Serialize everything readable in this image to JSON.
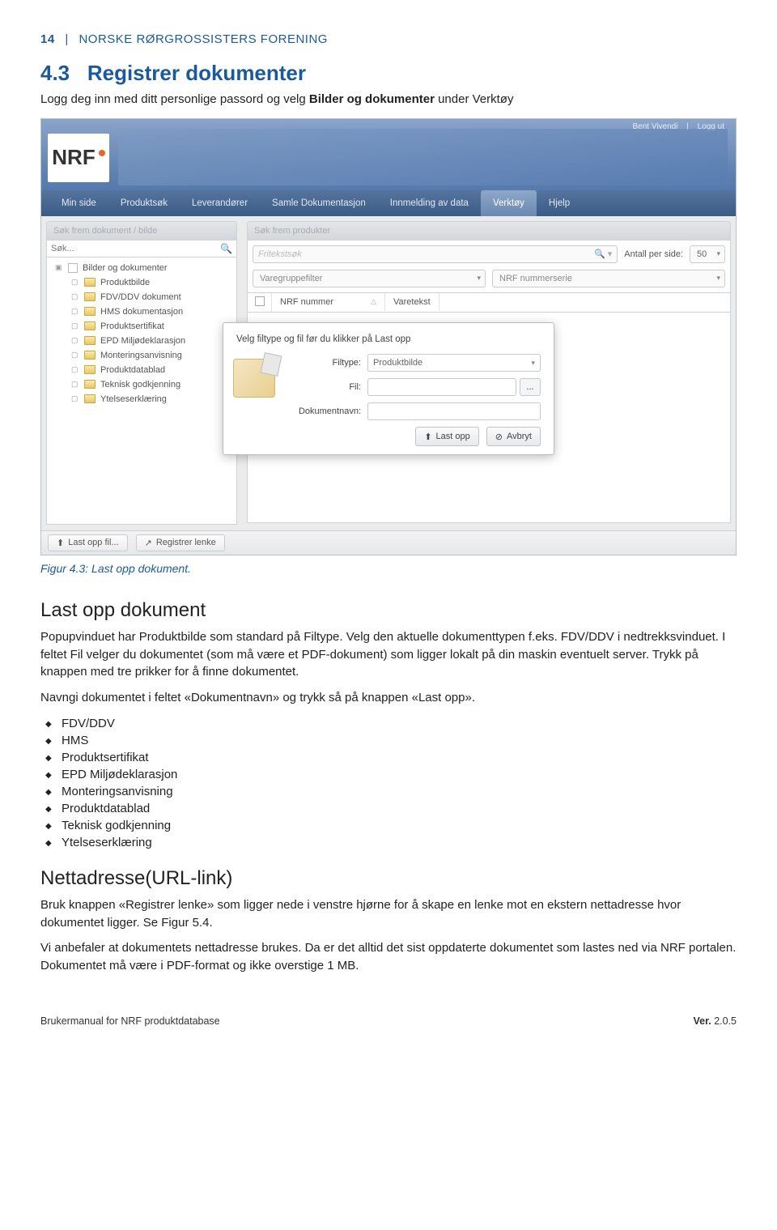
{
  "header": {
    "page_num": "14",
    "org": "NORSKE RØRGROSSISTERS FORENING"
  },
  "section": {
    "number": "4.3",
    "title": "Registrer dokumenter",
    "intro_pre": "Logg deg inn med ditt personlige passord og velg ",
    "intro_bold": "Bilder og dokumenter",
    "intro_post": " under Verktøy"
  },
  "screenshot": {
    "user": {
      "name": "Bent Vivendi",
      "logout": "Logg ut"
    },
    "nav": [
      "Min side",
      "Produktsøk",
      "Leverandører",
      "Samle Dokumentasjon",
      "Innmelding av data",
      "Verktøy",
      "Hjelp"
    ],
    "nav_active": "Verktøy",
    "left": {
      "header": "Søk frem dokument / bilde",
      "search_placeholder": "Søk...",
      "root": "Bilder og dokumenter",
      "items": [
        "Produktbilde",
        "FDV/DDV dokument",
        "HMS dokumentasjon",
        "Produktsertifikat",
        "EPD Miljødeklarasjon",
        "Monteringsanvisning",
        "Produktdatablad",
        "Teknisk godkjenning",
        "Ytelseserklæring"
      ]
    },
    "right": {
      "header": "Søk frem produkter",
      "fritext": "Fritekstsøk",
      "antall_label": "Antall per side:",
      "antall_value": "50",
      "filter1": "Varegruppefilter",
      "filter2": "NRF nummerserie",
      "col1": "NRF nummer",
      "col2": "Varetekst"
    },
    "modal": {
      "title": "Velg filtype og fil før du klikker på Last opp",
      "filtype_label": "Filtype:",
      "filtype_value": "Produktbilde",
      "fil_label": "Fil:",
      "browse": "...",
      "dokumentnavn_label": "Dokumentnavn:",
      "upload": "Last opp",
      "cancel": "Avbryt"
    },
    "bottom": {
      "upload_file": "Last opp fil...",
      "register_link": "Registrer lenke"
    }
  },
  "figure_caption": "Figur 4.3:  Last opp dokument.",
  "last_opp": {
    "heading": "Last opp dokument",
    "p1": "Popupvinduet har Produktbilde som standard på Filtype. Velg den aktuelle dokumenttypen f.eks. FDV/DDV i nedtrekksvinduet. I feltet Fil velger du dokumentet (som må være et PDF-dokument) som ligger lokalt på din maskin eventuelt server. Trykk på knappen med tre prikker for å finne dokumentet.",
    "p2": "Navngi dokumentet i feltet «Dokumentnavn» og trykk så på knappen «Last opp».",
    "list": [
      "FDV/DDV",
      "HMS",
      "Produktsertifikat",
      "EPD Miljødeklarasjon",
      "Monteringsanvisning",
      "Produktdatablad",
      "Teknisk godkjenning",
      "Ytelseserklæring"
    ]
  },
  "url": {
    "heading": "Nettadresse(URL-link)",
    "p1": "Bruk knappen «Registrer lenke» som ligger nede i venstre hjørne for å skape en lenke mot en ekstern nettadresse hvor dokumentet ligger. Se Figur 5.4.",
    "p2": "Vi anbefaler at dokumentets nettadresse brukes. Da er det alltid det sist oppdaterte dokumentet som lastes ned via NRF portalen. Dokumentet må være i PDF-format og ikke overstige 1 MB."
  },
  "footer": {
    "left": "Brukermanual for NRF produktdatabase",
    "right_label": "Ver.",
    "right_value": " 2.0.5"
  }
}
